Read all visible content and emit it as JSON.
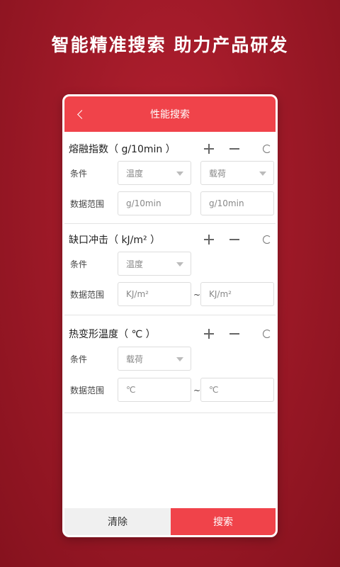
{
  "headline": "智能精准搜索 助力产品研发",
  "appbar": {
    "title": "性能搜索"
  },
  "sections": [
    {
      "title": "熔融指数（ g/10min ）",
      "condition_label": "条件",
      "condition_selects": [
        "温度",
        "载荷"
      ],
      "range_label": "数据范围",
      "range_placeholders": [
        "g/10min",
        "g/10min"
      ]
    },
    {
      "title": "缺口冲击（ kJ/m² ）",
      "condition_label": "条件",
      "condition_selects": [
        "温度"
      ],
      "range_label": "数据范围",
      "range_placeholders": [
        "KJ/m²",
        "KJ/m²"
      ],
      "separator": "~"
    },
    {
      "title": "热变形温度（ ℃ ）",
      "condition_label": "条件",
      "condition_selects": [
        "载荷"
      ],
      "range_label": "数据范围",
      "range_placeholders": [
        "℃",
        "℃"
      ],
      "separator": "~"
    }
  ],
  "footer": {
    "clear_label": "清除",
    "search_label": "搜索"
  },
  "colors": {
    "accent": "#f0434a",
    "background": "#9a1826"
  }
}
